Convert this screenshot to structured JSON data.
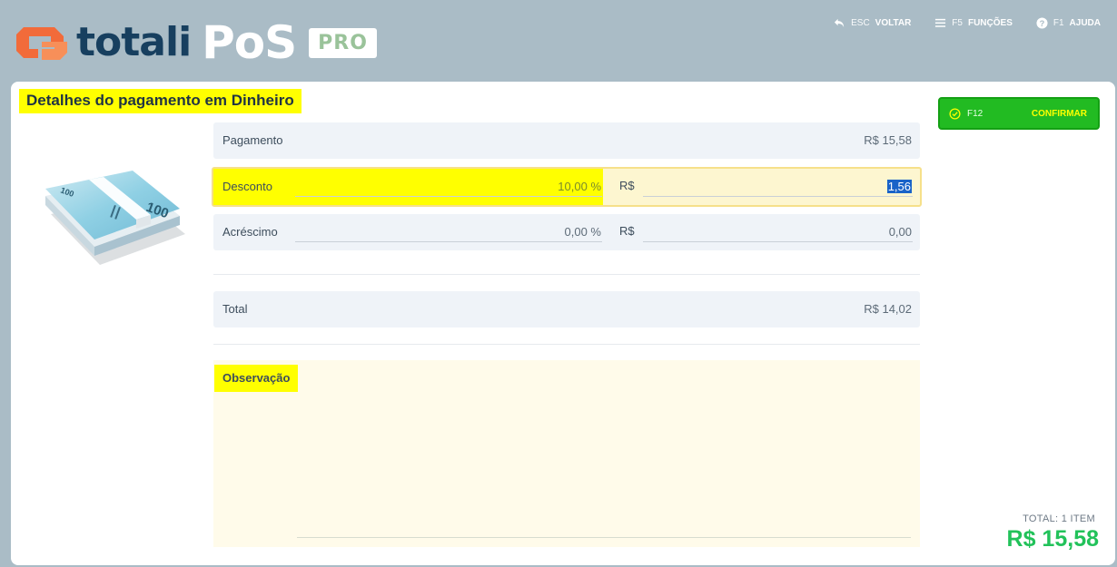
{
  "header": {
    "brand": "totali",
    "product": "PoS",
    "edition": "PRO",
    "nav": [
      {
        "key": "ESC",
        "label": "VOLTAR",
        "icon": "back-arrow-icon"
      },
      {
        "key": "F5",
        "label": "FUNÇÕES",
        "icon": "menu-icon"
      },
      {
        "key": "F1",
        "label": "AJUDA",
        "icon": "help-icon"
      }
    ]
  },
  "page": {
    "title": "Detalhes do pagamento em Dinheiro"
  },
  "payment": {
    "pagamento_label": "Pagamento",
    "pagamento_value": "R$ 15,58",
    "desconto_label": "Desconto",
    "desconto_pct": "10,00 %",
    "desconto_currency": "R$",
    "desconto_value": "1,56",
    "acrescimo_label": "Acréscimo",
    "acrescimo_pct": "0,00 %",
    "acrescimo_currency": "R$",
    "acrescimo_value": "0,00",
    "total_label": "Total",
    "total_value": "R$ 14,02",
    "observacao_label": "Observação",
    "observacao_value": ""
  },
  "actions": {
    "confirm_key": "F12",
    "confirm_label": "CONFIRMAR"
  },
  "summary": {
    "count": "TOTAL: 1 ITEM",
    "amount": "R$ 15,58"
  },
  "colors": {
    "background": "#aabcc6",
    "brand_navy": "#173f5f",
    "brand_orange": "#f26b3a",
    "highlight": "#ffff00",
    "confirm_green": "#22bb22",
    "total_green": "#22c25a"
  }
}
